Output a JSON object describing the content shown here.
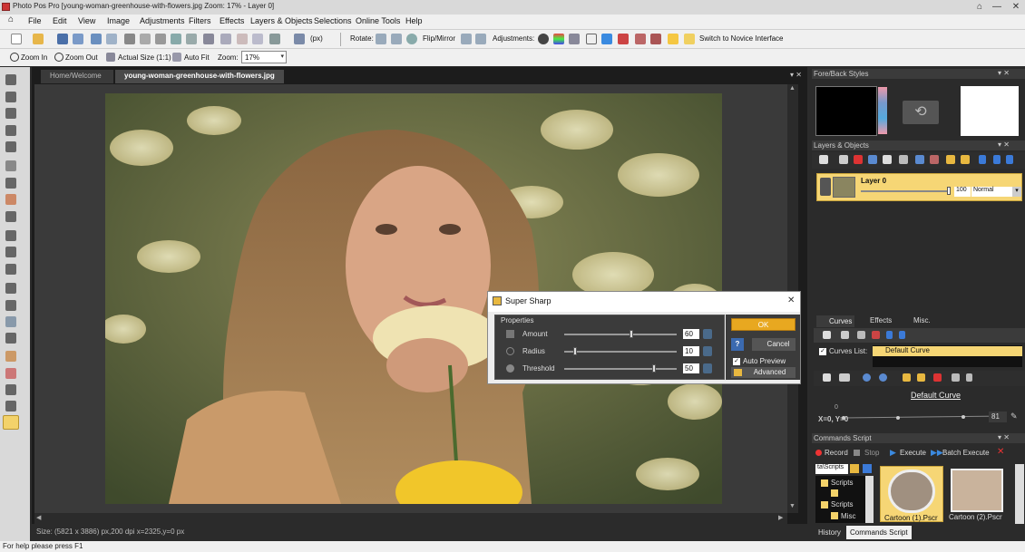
{
  "window": {
    "title": "Photo Pos Pro [young-woman-greenhouse-with-flowers.jpg Zoom: 17% - Layer 0]",
    "controls": [
      "⌂",
      "—",
      "☐",
      "✕"
    ]
  },
  "menu": [
    "File",
    "Edit",
    "View",
    "Image",
    "Adjustments",
    "Filters",
    "Effects",
    "Layers & Objects",
    "Selections",
    "Online Tools",
    "Help"
  ],
  "toolbar1": {
    "units": "(px)",
    "rotate": "Rotate:",
    "flip": "Flip/Mirror",
    "adjustments": "Adjustments:",
    "novice": "Switch to Novice Interface"
  },
  "toolbar2": {
    "zoom_in": "Zoom In",
    "zoom_out": "Zoom Out",
    "actual_size": "Actual Size (1:1)",
    "auto_fit": "Auto Fit",
    "zoom_label": "Zoom:",
    "zoom_value": "17%"
  },
  "tabs": {
    "home": "Home/Welcome",
    "doc": "young-woman-greenhouse-with-flowers.jpg"
  },
  "status": {
    "doc": "Size: (5821 x 3886) px,200 dpi   x=2325,y=0 px",
    "help": "For help please press F1"
  },
  "panels": {
    "fore_back": "Fore/Back Styles",
    "layers": "Layers & Objects",
    "layer_name": "Layer 0",
    "opacity": "100",
    "blend": "Normal",
    "curves_tab": "Curves",
    "effects_tab": "Effects",
    "misc_tab": "Misc.",
    "curves_list_label": "Curves List:",
    "curves_list_item": "Default Curve",
    "curve_name": "Default Curve",
    "curve_coords": "X=0, Y=0",
    "curve_axis_label": "0",
    "curve_value": "81",
    "commands": "Commands Script",
    "record": "Record",
    "stop": "Stop",
    "execute": "Execute",
    "batch": "Batch Execute",
    "path": "ta\\Scripts",
    "tree": [
      "Scripts",
      "Scripts",
      "Misc"
    ],
    "thumb1": "Cartoon (1).Pscr",
    "thumb2": "Cartoon (2).Pscr",
    "history_tab": "History",
    "commands_tab": "Commands Script"
  },
  "dialog": {
    "title": "Super Sharp",
    "group": "Properties",
    "params": [
      {
        "label": "Amount",
        "value": "60",
        "level": 0.6
      },
      {
        "label": "Radius",
        "value": "10",
        "level": 0.1
      },
      {
        "label": "Threshold",
        "value": "50",
        "level": 0.8
      }
    ],
    "ok": "OK",
    "cancel": "Cancel",
    "help": "?",
    "auto_preview": "Auto Preview",
    "advanced": "Advanced"
  },
  "colors": {
    "accent": "#f5c742",
    "dark": "#2b2b2b",
    "photo_bg": "#6a7748"
  }
}
